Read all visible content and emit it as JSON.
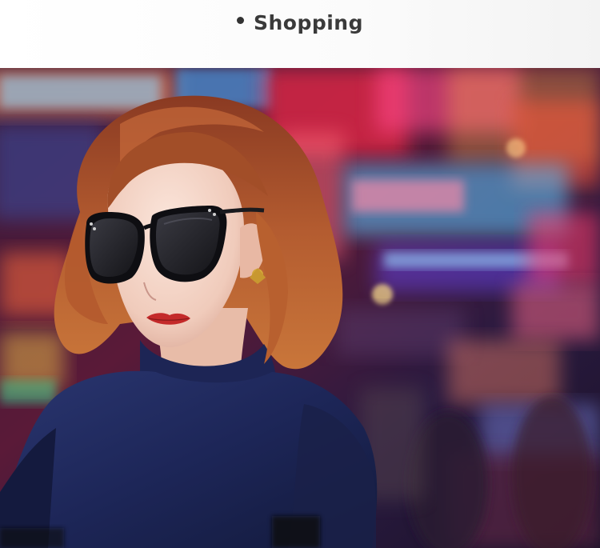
{
  "section": {
    "title": "Shopping"
  },
  "photo": {
    "subject": "woman-with-sunglasses",
    "colors": {
      "neon_pink": "#ff3a7a",
      "neon_blue": "#6fc8ff",
      "neon_red": "#ff2a3a",
      "hair": "#a8552e",
      "top": "#1c2450"
    }
  }
}
